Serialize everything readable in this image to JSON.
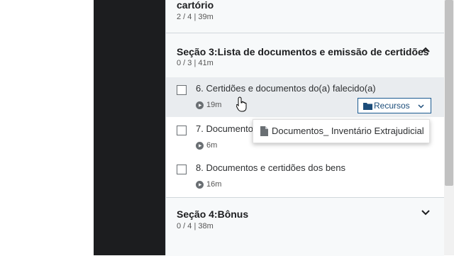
{
  "sections": {
    "prev": {
      "title": "cartório",
      "meta": "2 / 4 | 39m"
    },
    "s3": {
      "title": "Seção 3:Lista de documentos e emissão de certidões",
      "meta": "0 / 3 | 41m",
      "expanded": true
    },
    "s4": {
      "title": "Seção 4:Bônus",
      "meta": "0 / 4 | 38m",
      "expanded": false
    }
  },
  "lectures": [
    {
      "title": "6. Certidões e documentos do(a) falecido(a)",
      "duration": "19m",
      "active": true
    },
    {
      "title": "7. Documento",
      "duration": "6m"
    },
    {
      "title": "8. Documentos e certidões dos bens",
      "duration": "16m"
    }
  ],
  "resources": {
    "button_label": "Recursos",
    "items": [
      {
        "label": "Documentos_ Inventário Extrajudicial"
      }
    ]
  },
  "icons": {
    "chevron_up": "chevron-up-icon",
    "chevron_down": "chevron-down-icon",
    "play": "play-circle-icon",
    "folder": "folder-icon",
    "file": "file-icon",
    "cursor": "hand-cursor-icon"
  },
  "colors": {
    "accent": "#1c5b91",
    "dark_panel": "#1c1d1f",
    "section_bg": "#f7f9fa",
    "active_bg": "#e9ecef"
  }
}
